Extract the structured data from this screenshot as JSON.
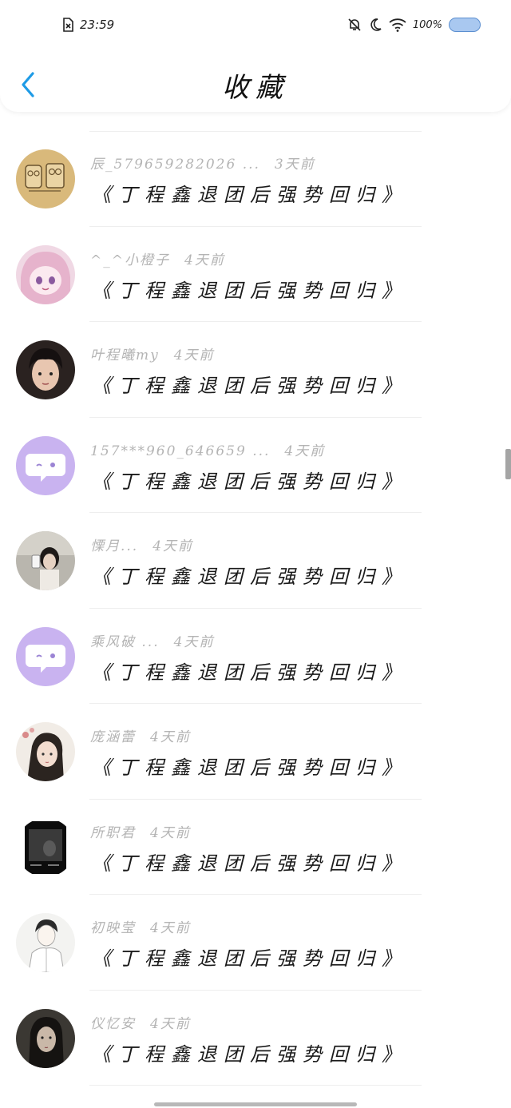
{
  "status_bar": {
    "time": "23:59",
    "battery_percent": "100%",
    "battery_level": 1.0,
    "icons": [
      "sim-error-icon",
      "mute-bell-icon",
      "moon-icon",
      "wifi-icon",
      "battery-icon"
    ]
  },
  "nav": {
    "title": "收藏",
    "back_icon": "chevron-left-icon"
  },
  "colors": {
    "accent": "#1e9be6",
    "meta_text": "#b4b4b4",
    "avatar_purple": "#c9b3f0"
  },
  "items": [
    {
      "author": "辰_579659282026 ...",
      "time": "3天前",
      "title": "《丁程鑫退团后强势回归》",
      "avatar": "cartoon-sponge"
    },
    {
      "author": "^_^小橙子",
      "time": "4天前",
      "title": "《丁程鑫退团后强势回归》",
      "avatar": "anime-pink-girl"
    },
    {
      "author": "叶程曦my",
      "time": "4天前",
      "title": "《丁程鑫退团后强势回归》",
      "avatar": "boy-portrait"
    },
    {
      "author": "157***960_646659 ...",
      "time": "4天前",
      "title": "《丁程鑫退团后强势回归》",
      "avatar": "default-chat"
    },
    {
      "author": "慄月...",
      "time": "4天前",
      "title": "《丁程鑫退团后强势回归》",
      "avatar": "girl-photo"
    },
    {
      "author": "乘风破 ...",
      "time": "4天前",
      "title": "《丁程鑫退团后强势回归》",
      "avatar": "default-chat"
    },
    {
      "author": "庞涵蕾",
      "time": "4天前",
      "title": "《丁程鑫退团后强势回归》",
      "avatar": "painted-girl"
    },
    {
      "author": "所职君",
      "time": "4天前",
      "title": "《丁程鑫退团后强势回归》",
      "avatar": "dark-square"
    },
    {
      "author": "初映莹",
      "time": "4天前",
      "title": "《丁程鑫退团后强势回归》",
      "avatar": "sketch-boy"
    },
    {
      "author": "仪忆安",
      "time": "4天前",
      "title": "《丁程鑫退团后强势回归》",
      "avatar": "dark-girl"
    }
  ]
}
